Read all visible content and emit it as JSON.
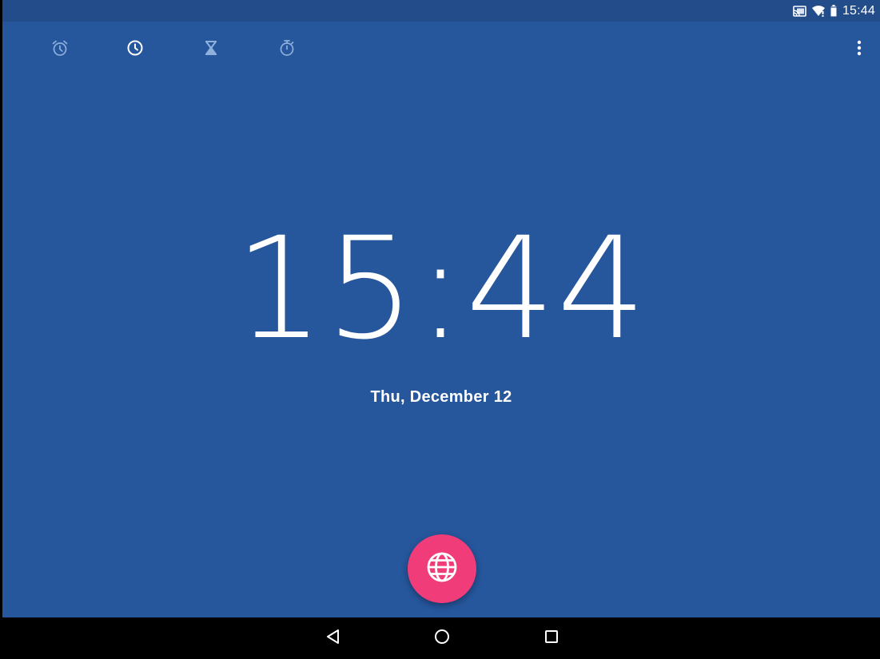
{
  "status_bar": {
    "time": "15:44",
    "icons": [
      "cast-icon",
      "wifi-icon",
      "battery-icon"
    ],
    "background": "#224c8a"
  },
  "tabs": [
    {
      "icon": "alarm-icon",
      "selected": false
    },
    {
      "icon": "clock-icon",
      "selected": true
    },
    {
      "icon": "timer-icon",
      "selected": false
    },
    {
      "icon": "stopwatch-icon",
      "selected": false
    }
  ],
  "overflow_menu_icon": "more-vert-icon",
  "clock": {
    "time": "15:44",
    "date": "Thu, December 12"
  },
  "fab": {
    "icon": "globe-icon",
    "color": "#f03c78"
  },
  "nav_bar": {
    "buttons": [
      "back-icon",
      "home-icon",
      "recents-icon"
    ]
  },
  "colors": {
    "background": "#26569c",
    "accent": "#f03c78",
    "text": "#ffffff"
  }
}
